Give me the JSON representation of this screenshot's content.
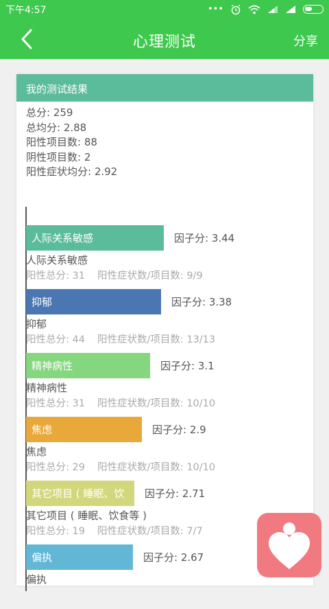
{
  "status": {
    "time": "下午4:57",
    "icons": [
      "dots-icon",
      "alarm-icon",
      "wifi-icon",
      "signal-icon",
      "signal-icon",
      "battery-icon"
    ]
  },
  "nav": {
    "title": "心理测试",
    "share": "分享"
  },
  "card": {
    "header": "我的测试结果",
    "summary": [
      "总分: 259",
      "总均分: 2.88",
      "阳性项目数: 88",
      "阴性项目数: 2",
      "阳性症状均分: 2.92"
    ]
  },
  "factors": [
    {
      "bar_label": "人际关系敏感",
      "score_text": "因子分: 3.44",
      "score": 3.44,
      "name": "人际关系敏感",
      "positive_total": "阳性总分: 31",
      "ratio": "阳性症状数/项目数: 9/9",
      "color": "#5bbc9b"
    },
    {
      "bar_label": "抑郁",
      "score_text": "因子分: 3.38",
      "score": 3.38,
      "name": "抑郁",
      "positive_total": "阳性总分: 44",
      "ratio": "阳性症状数/项目数: 13/13",
      "color": "#4a76b2"
    },
    {
      "bar_label": "精神病性",
      "score_text": "因子分: 3.1",
      "score": 3.1,
      "name": "精神病性",
      "positive_total": "阳性总分: 31",
      "ratio": "阳性症状数/项目数: 10/10",
      "color": "#86d67f"
    },
    {
      "bar_label": "焦虑",
      "score_text": "因子分: 2.9",
      "score": 2.9,
      "name": "焦虑",
      "positive_total": "阳性总分: 29",
      "ratio": "阳性症状数/项目数: 10/10",
      "color": "#e9a93a"
    },
    {
      "bar_label": "其它项目 ( 睡眠、饮",
      "score_text": "因子分: 2.71",
      "score": 2.71,
      "name": "其它项目 ( 睡眠、饮食等 )",
      "positive_total": "阳性总分: 19",
      "ratio": "阳性症状数/项目数: 7/7",
      "color": "#d3d77c"
    },
    {
      "bar_label": "偏执",
      "score_text": "因子分: 2.67",
      "score": 2.67,
      "name": "偏执",
      "positive_total": "",
      "ratio": "",
      "color": "#62b7d6"
    }
  ],
  "fab": {
    "icon": "heart-person-icon"
  }
}
